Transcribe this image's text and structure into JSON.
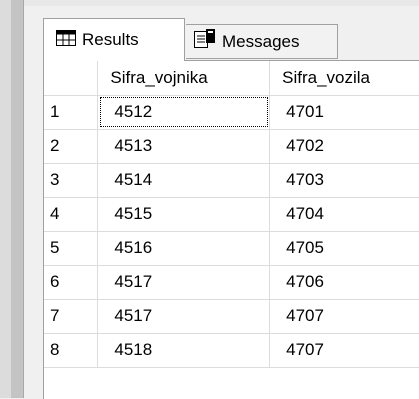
{
  "tabs": {
    "results_label": "Results",
    "messages_label": "Messages"
  },
  "grid": {
    "columns": [
      "",
      "Sifra_vojnika",
      "Sifra_vozila"
    ],
    "rows": [
      {
        "num": "1",
        "sifra_vojnika": "4512",
        "sifra_vozila": "4701"
      },
      {
        "num": "2",
        "sifra_vojnika": "4513",
        "sifra_vozila": "4702"
      },
      {
        "num": "3",
        "sifra_vojnika": "4514",
        "sifra_vozila": "4703"
      },
      {
        "num": "4",
        "sifra_vojnika": "4515",
        "sifra_vozila": "4704"
      },
      {
        "num": "5",
        "sifra_vojnika": "4516",
        "sifra_vozila": "4705"
      },
      {
        "num": "6",
        "sifra_vojnika": "4517",
        "sifra_vozila": "4706"
      },
      {
        "num": "7",
        "sifra_vojnika": "4517",
        "sifra_vozila": "4707"
      },
      {
        "num": "8",
        "sifra_vojnika": "4518",
        "sifra_vozila": "4707"
      }
    ]
  }
}
